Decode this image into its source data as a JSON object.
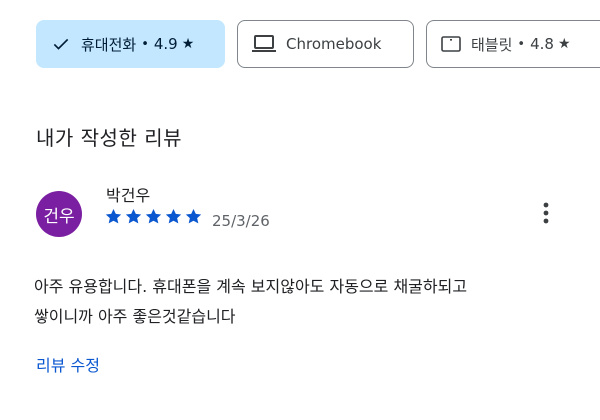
{
  "device_chips": [
    {
      "label": "휴대전화",
      "rating": "4.9",
      "star": "★",
      "separator": "•",
      "icon": "check-icon",
      "selected": true
    },
    {
      "label": "Chromebook",
      "icon": "laptop-icon",
      "selected": false
    },
    {
      "label": "태블릿",
      "rating": "4.8",
      "star": "★",
      "separator": "•",
      "icon": "tablet-icon",
      "selected": false
    }
  ],
  "section_title": "내가 작성한 리뷰",
  "review": {
    "avatar_text": "건우",
    "avatar_color": "#7b1fa2",
    "author": "박건우",
    "stars": 5,
    "date": "25/3/26",
    "text_lines": [
      "아주 유용합니다. 휴대폰을 계속 보지않아도 자동으로 채굴하되고",
      "쌓이니까 아주 좋은것같습니다"
    ],
    "more_icon": "more-vert-icon"
  },
  "edit_link": "리뷰 수정",
  "colors": {
    "selected_chip": "#c2e7ff",
    "star": "#0b57d0",
    "link": "#0b57d0"
  }
}
